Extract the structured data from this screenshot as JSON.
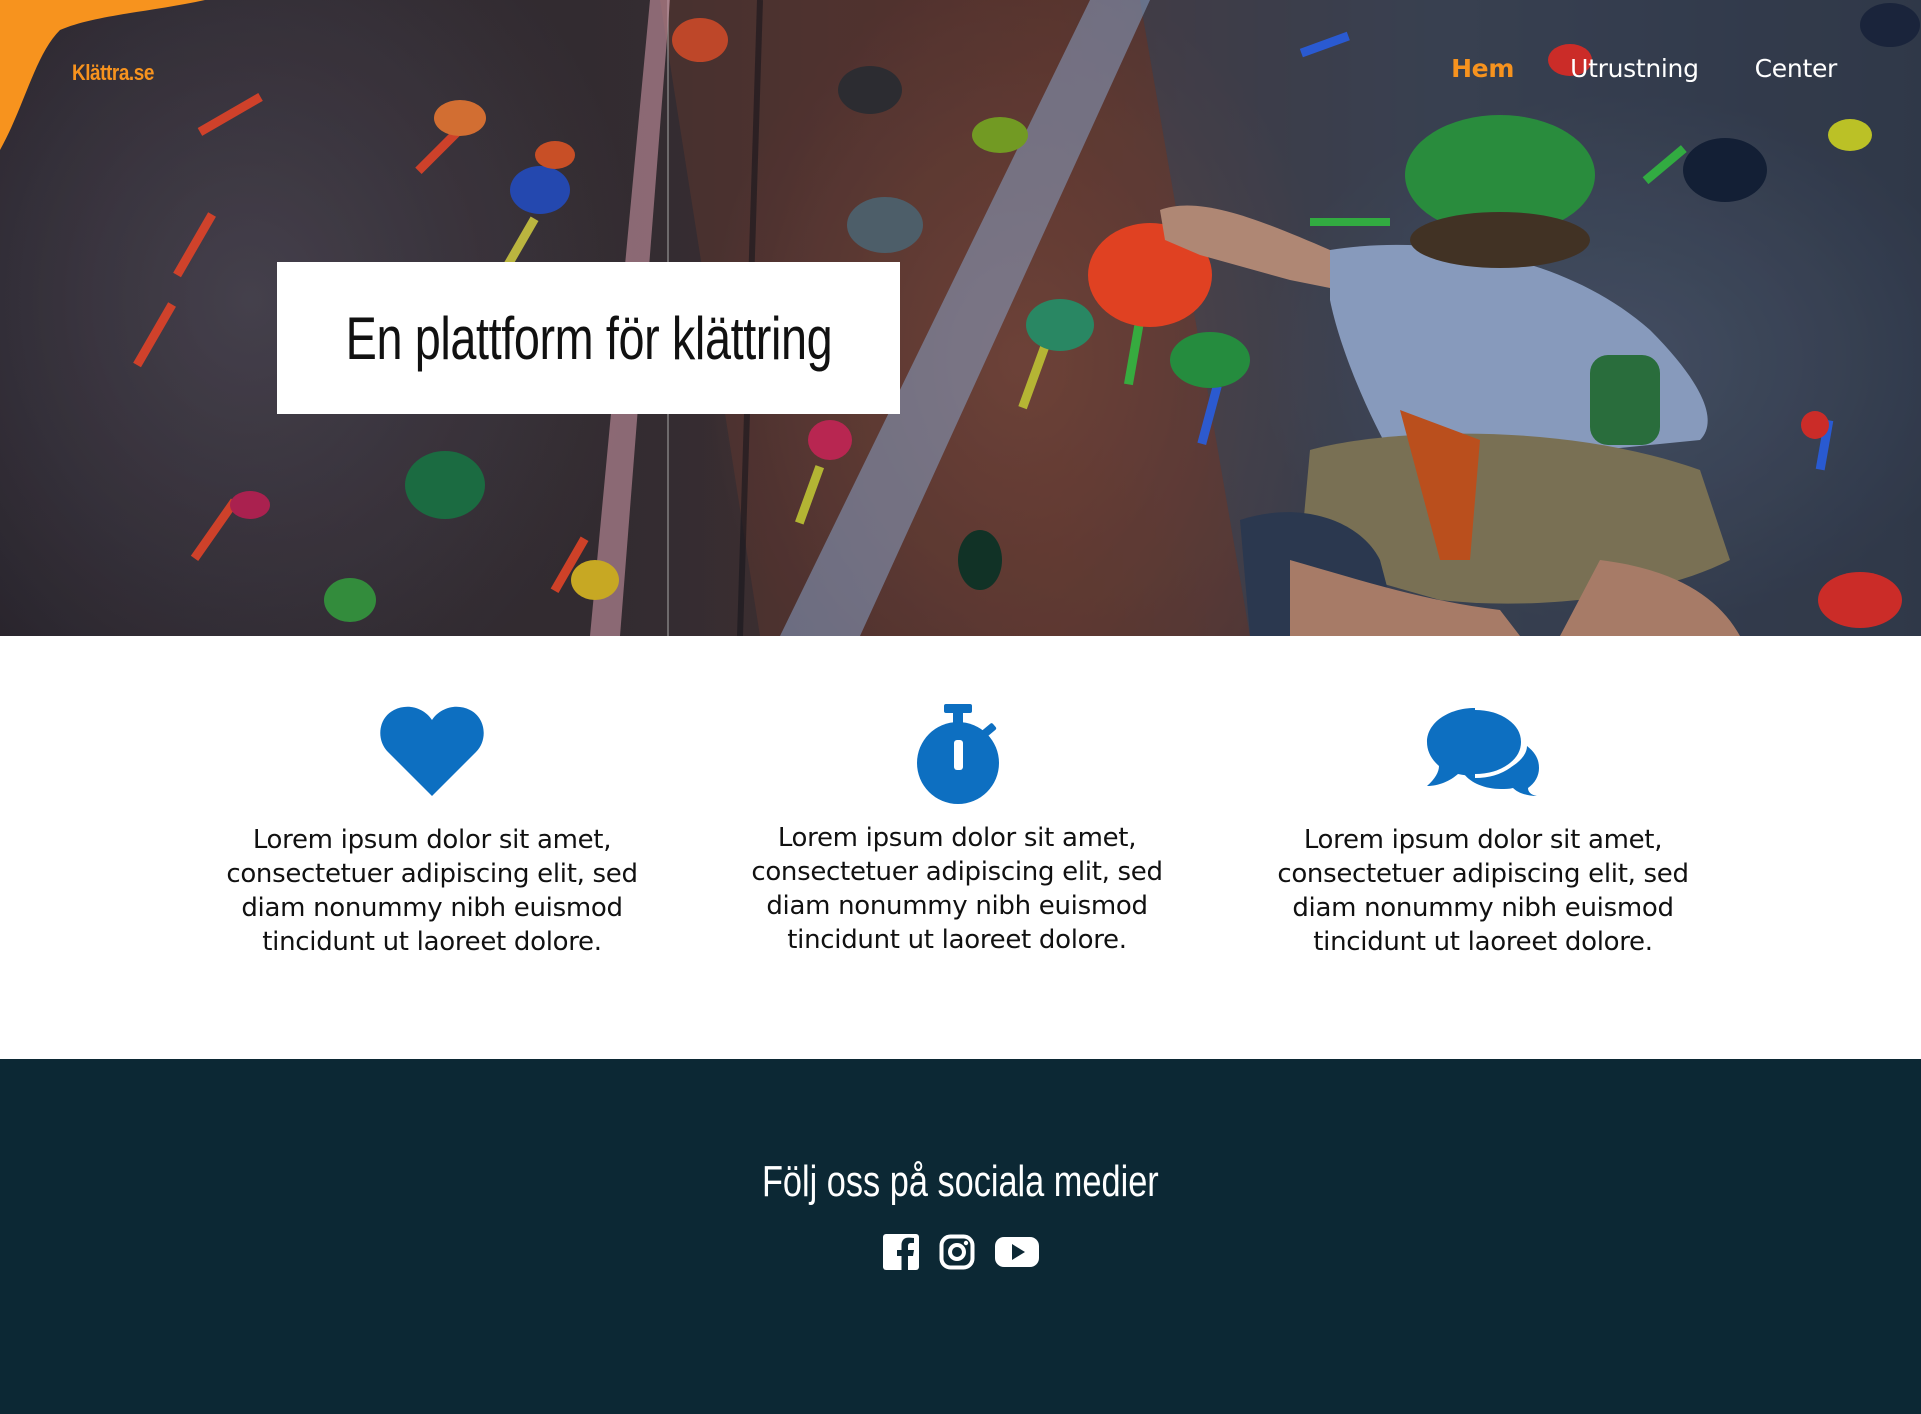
{
  "header": {
    "logo": "Klättra.se",
    "nav": [
      {
        "label": "Hem",
        "active": true
      },
      {
        "label": "Utrustning",
        "active": false
      },
      {
        "label": "Center",
        "active": false
      }
    ]
  },
  "hero": {
    "title": "En plattform för klättring"
  },
  "features": [
    {
      "icon": "heart-icon",
      "text": "Lorem ipsum dolor sit amet, consectetuer adipiscing elit, sed diam nonummy nibh euismod tincidunt ut laoreet dolore."
    },
    {
      "icon": "stopwatch-icon",
      "text": "Lorem ipsum dolor sit amet, consectetuer adipiscing elit, sed diam nonummy nibh euismod tincidunt ut laoreet dolore."
    },
    {
      "icon": "chat-bubbles-icon",
      "text": "Lorem ipsum dolor sit amet, consectetuer adipiscing elit, sed diam nonummy nibh euismod tincidunt ut laoreet dolore."
    }
  ],
  "footer": {
    "title": "Följ oss på sociala medier",
    "social": [
      "facebook-icon",
      "instagram-icon",
      "youtube-icon"
    ]
  },
  "colors": {
    "accent": "#f7931e",
    "icon_blue": "#0d6fc1",
    "footer_bg": "#0c2834"
  }
}
